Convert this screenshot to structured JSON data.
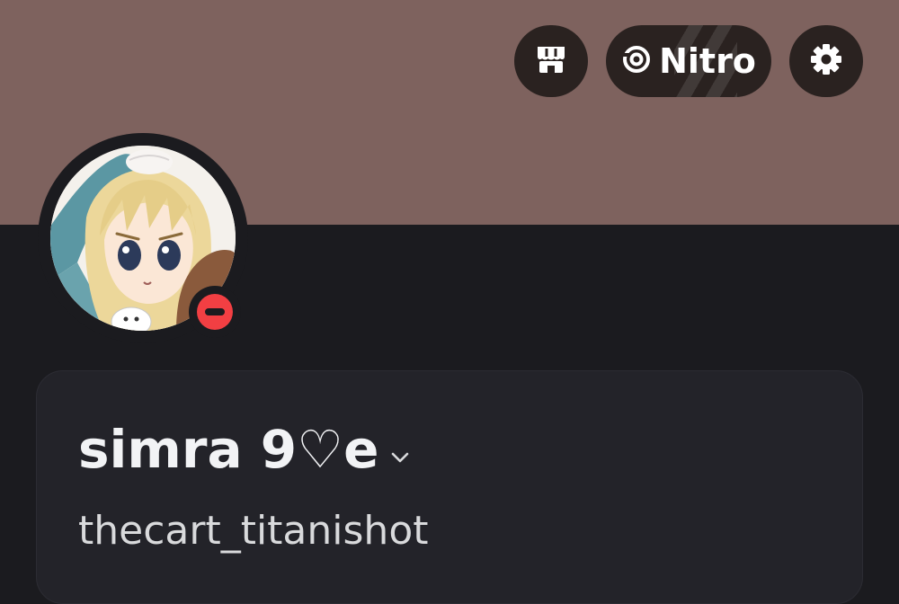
{
  "profile": {
    "banner_color": "#7e625e",
    "display_name": "simra 9♡e",
    "username": "thecart_titanishot",
    "status": "do-not-disturb",
    "status_color": "#f23f43"
  },
  "header": {
    "shop_icon": "shop-icon",
    "nitro_label": "Nitro",
    "nitro_icon": "nitro-icon",
    "settings_icon": "gear-icon"
  }
}
